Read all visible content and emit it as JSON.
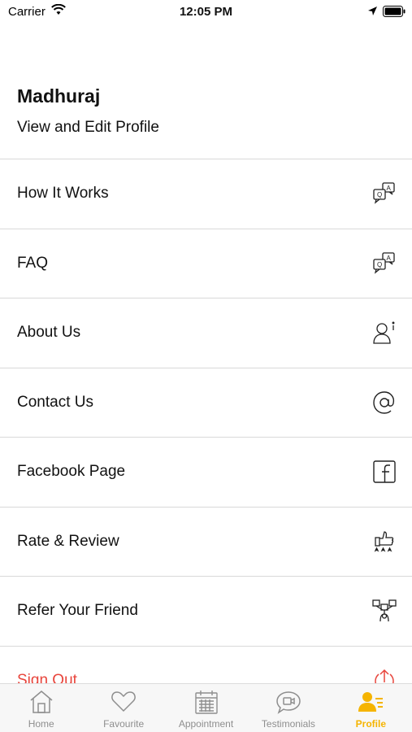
{
  "status_bar": {
    "carrier": "Carrier",
    "time": "12:05 PM"
  },
  "profile": {
    "name": "Madhuraj",
    "edit_link": "View and Edit Profile"
  },
  "menu": {
    "items": [
      {
        "label": "How It Works",
        "icon": "qa-chat-icon"
      },
      {
        "label": "FAQ",
        "icon": "qa-chat-icon"
      },
      {
        "label": "About Us",
        "icon": "person-info-icon"
      },
      {
        "label": "Contact Us",
        "icon": "at-sign-icon"
      },
      {
        "label": "Facebook Page",
        "icon": "facebook-icon"
      },
      {
        "label": "Rate & Review",
        "icon": "thumbs-up-stars-icon"
      },
      {
        "label": "Refer Your Friend",
        "icon": "share-network-icon"
      },
      {
        "label": "Sign Out",
        "icon": "sign-out-icon"
      }
    ]
  },
  "tab_bar": {
    "tabs": [
      {
        "label": "Home",
        "icon": "home-icon"
      },
      {
        "label": "Favourite",
        "icon": "heart-icon"
      },
      {
        "label": "Appointment",
        "icon": "calendar-icon"
      },
      {
        "label": "Testimonials",
        "icon": "video-chat-icon"
      },
      {
        "label": "Profile",
        "icon": "profile-icon"
      }
    ],
    "active": "Profile"
  },
  "colors": {
    "accent": "#f5b400",
    "sign_out": "#e8453c",
    "divider": "#d9d9d9",
    "tab_inactive": "#8e8e8e"
  }
}
